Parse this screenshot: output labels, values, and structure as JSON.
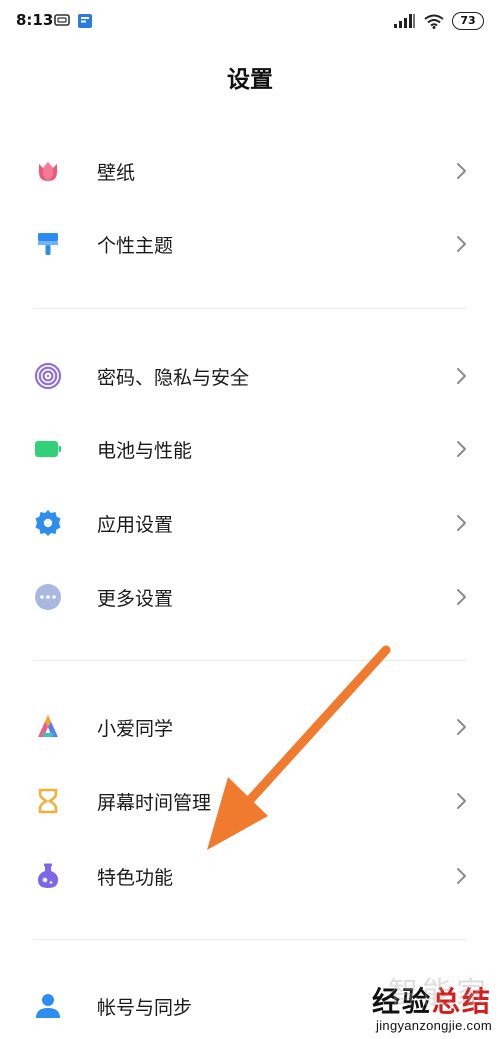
{
  "status_bar": {
    "time": "8:13",
    "battery": "73",
    "icons": [
      "screen-cast-icon",
      "app-notification-icon",
      "signal-icon",
      "wifi-icon",
      "battery-icon"
    ]
  },
  "header": {
    "title": "设置"
  },
  "sections": [
    {
      "items": [
        {
          "label": "壁纸",
          "icon": "tulip-icon",
          "color": "#f0587a"
        },
        {
          "label": "个性主题",
          "icon": "paint-brush-icon",
          "color": "#2f8bf0"
        }
      ]
    },
    {
      "items": [
        {
          "label": "密码、隐私与安全",
          "icon": "fingerprint-icon",
          "color": "#8f6fe0"
        },
        {
          "label": "电池与性能",
          "icon": "battery-icon",
          "color": "#33d07a"
        },
        {
          "label": "应用设置",
          "icon": "gear-icon",
          "color": "#2e8ef0"
        },
        {
          "label": "更多设置",
          "icon": "more-dots-icon",
          "color": "#a9b8df"
        }
      ]
    },
    {
      "items": [
        {
          "label": "小爱同学",
          "icon": "xiaoai-icon",
          "color": "#5a7df0"
        },
        {
          "label": "屏幕时间管理",
          "icon": "hourglass-icon",
          "color": "#f3b03b"
        },
        {
          "label": "特色功能",
          "icon": "flask-icon",
          "color": "#7a68e8"
        }
      ]
    },
    {
      "items": [
        {
          "label": "帐号与同步",
          "icon": "user-icon",
          "color": "#2e8ef0"
        }
      ]
    }
  ],
  "annotation": {
    "arrow_color": "#f07a2e"
  },
  "watermark": {
    "brand_part1": "经验",
    "brand_part2": "总结",
    "ghost_text": "智能家",
    "url": "jingyanzongjie.com"
  }
}
